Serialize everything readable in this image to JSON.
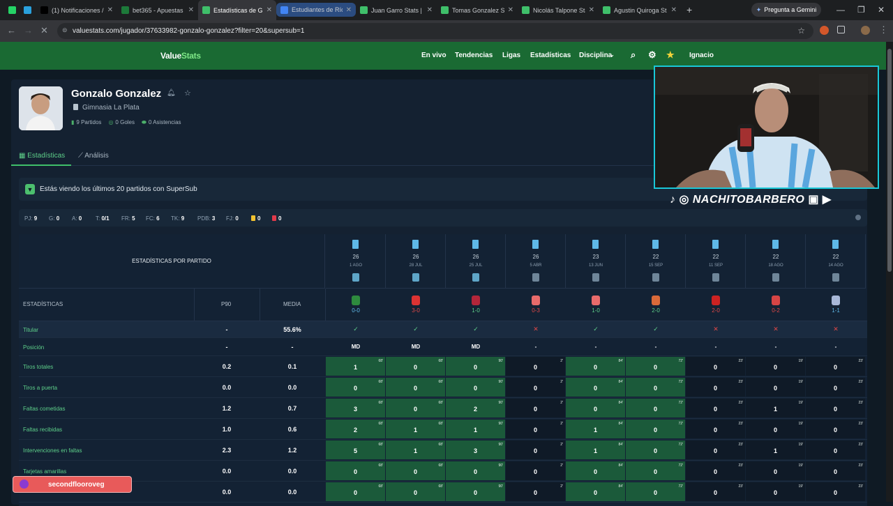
{
  "browser": {
    "tabs": [
      {
        "label": "",
        "icon": "whatsapp-icon",
        "color": "#25d366"
      },
      {
        "label": "",
        "icon": "telegram-icon",
        "color": "#2aa1dd"
      },
      {
        "label": "(1) Notificaciones /",
        "icon": "x-icon",
        "color": "#000000"
      },
      {
        "label": "bet365 - Apuestas",
        "icon": "bet365-icon",
        "color": "#1d7a3a"
      },
      {
        "label": "Estadísticas de G",
        "icon": "valuestats-icon",
        "color": "#3fbf6a"
      },
      {
        "label": "Estudiantes de Río",
        "icon": "google-icon",
        "color": "#4285f4"
      },
      {
        "label": "Juan Garro Stats |",
        "icon": "valuestats-icon",
        "color": "#3fbf6a"
      },
      {
        "label": "Tomas Gonzalez St",
        "icon": "valuestats-icon",
        "color": "#3fbf6a"
      },
      {
        "label": "Nicolás Talpone Sta",
        "icon": "valuestats-icon",
        "color": "#3fbf6a"
      },
      {
        "label": "Agustin Quiroga St",
        "icon": "valuestats-icon",
        "color": "#3fbf6a"
      }
    ],
    "new_tab": "+",
    "gemini": "Pregunta a Gemini",
    "url": "valuestats.com/jugador/37633982-gonzalo-gonzalez?filter=20&supersub=1"
  },
  "app": {
    "logo": "ValueStats",
    "menu": [
      "En vivo",
      "Tendencias",
      "Ligas",
      "Estadísticas",
      "Disciplina"
    ],
    "user": "Ignacio"
  },
  "player": {
    "name": "Gonzalo Gonzalez",
    "team": "Gimnasia La Plata",
    "matches": "9 Partidos",
    "goals": "0 Goles",
    "assists": "0 Asistencias"
  },
  "tabs": {
    "stats": "Estadísticas",
    "analysis": "Análisis"
  },
  "banner": "Estás viendo los últimos 20 partidos con SuperSub",
  "summary": [
    {
      "k": "PJ:",
      "v": "9"
    },
    {
      "k": "G:",
      "v": "0"
    },
    {
      "k": "A:",
      "v": "0"
    },
    {
      "k": "T:",
      "v": "0/1"
    },
    {
      "k": "FR:",
      "v": "5"
    },
    {
      "k": "FC:",
      "v": "6"
    },
    {
      "k": "TK:",
      "v": "9"
    },
    {
      "k": "PDB:",
      "v": "3"
    },
    {
      "k": "FJ:",
      "v": "0"
    },
    {
      "k": "",
      "v": "0"
    },
    {
      "k": "",
      "v": "0"
    }
  ],
  "table": {
    "title": "ESTADÍSTICAS POR PARTIDO",
    "col_stats": "ESTADÍSTICAS",
    "col_p90": "P90",
    "col_media": "MEDIA",
    "matches": [
      {
        "round": "26",
        "date": "1 AGO",
        "score": "0-0",
        "scolor": "#5fb9e8",
        "oppcolor": "#2e8b3e"
      },
      {
        "round": "26",
        "date": "28 JUL",
        "score": "3-0",
        "scolor": "#e14848",
        "oppcolor": "#d33"
      },
      {
        "round": "26",
        "date": "25 JUL",
        "score": "1-0",
        "scolor": "#5ed08a",
        "oppcolor": "#b3263a"
      },
      {
        "round": "26",
        "date": "5 ABR",
        "score": "0-3",
        "scolor": "#e14848",
        "oppcolor": "#e86b6b"
      },
      {
        "round": "23",
        "date": "13 JUN",
        "score": "1-0",
        "scolor": "#5ed08a",
        "oppcolor": "#e86b6b"
      },
      {
        "round": "22",
        "date": "15 SEP",
        "score": "2-0",
        "scolor": "#5ed08a",
        "oppcolor": "#d96a3a"
      },
      {
        "round": "22",
        "date": "11 SEP",
        "score": "2-0",
        "scolor": "#e14848",
        "oppcolor": "#cc2222"
      },
      {
        "round": "22",
        "date": "18 AGO",
        "score": "0-2",
        "scolor": "#e14848",
        "oppcolor": "#d74545"
      },
      {
        "round": "22",
        "date": "14 AGO",
        "score": "1-1",
        "scolor": "#5fb9e8",
        "oppcolor": "#a8b8d8"
      }
    ],
    "titular": {
      "label": "Titular",
      "p90": "-",
      "media": "55.6%",
      "marks": [
        "✓",
        "✓",
        "✓",
        "✕",
        "✓",
        "✓",
        "✕",
        "✕",
        "✕"
      ]
    },
    "posicion": {
      "label": "Posición",
      "p90": "-",
      "media": "-",
      "values": [
        "MD",
        "MD",
        "MD",
        "-",
        "-",
        "-",
        "-",
        "-",
        "-"
      ]
    },
    "minutes": [
      "68'",
      "68'",
      "90'",
      "2'",
      "84'",
      "72'",
      "23'",
      "19'",
      "23'"
    ],
    "rows": [
      {
        "label": "Tiros totales",
        "p90": "0.2",
        "media": "0.1",
        "values": [
          "1",
          "0",
          "0",
          "0",
          "0",
          "0",
          "0",
          "0",
          "0"
        ]
      },
      {
        "label": "Tiros a puerta",
        "p90": "0.0",
        "media": "0.0",
        "values": [
          "0",
          "0",
          "0",
          "0",
          "0",
          "0",
          "0",
          "0",
          "0"
        ]
      },
      {
        "label": "Faltas cometidas",
        "p90": "1.2",
        "media": "0.7",
        "values": [
          "3",
          "0",
          "2",
          "0",
          "0",
          "0",
          "0",
          "1",
          "0"
        ]
      },
      {
        "label": "Faltas recibidas",
        "p90": "1.0",
        "media": "0.6",
        "values": [
          "2",
          "1",
          "1",
          "0",
          "1",
          "0",
          "0",
          "0",
          "0"
        ]
      },
      {
        "label": "Intervenciones en faltas",
        "p90": "2.3",
        "media": "1.2",
        "values": [
          "5",
          "1",
          "3",
          "0",
          "1",
          "0",
          "0",
          "1",
          "0"
        ]
      },
      {
        "label": "Tarjetas amarillas",
        "p90": "0.0",
        "media": "0.0",
        "values": [
          "0",
          "0",
          "0",
          "0",
          "0",
          "0",
          "0",
          "0",
          "0"
        ]
      },
      {
        "label": "",
        "p90": "0.0",
        "media": "0.0",
        "values": [
          "0",
          "0",
          "0",
          "0",
          "0",
          "0",
          "0",
          "0",
          "0"
        ]
      }
    ]
  },
  "overlay": {
    "handle": "NACHITOBARBERO",
    "chat_user": "secondflooroveg"
  }
}
